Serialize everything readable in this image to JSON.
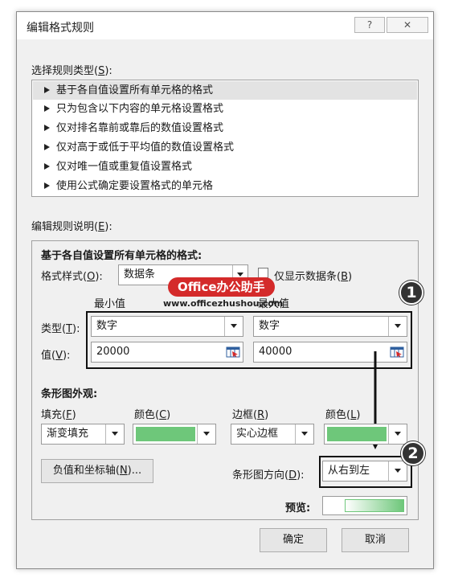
{
  "dialog": {
    "title": "编辑格式规则",
    "help_glyph": "?",
    "close_glyph": "✕"
  },
  "rule_type": {
    "label": "选择规则类型(",
    "label_key": "S",
    "label_tail": "):",
    "items": [
      "基于各自值设置所有单元格的格式",
      "只为包含以下内容的单元格设置格式",
      "仅对排名靠前或靠后的数值设置格式",
      "仅对高于或低于平均值的数值设置格式",
      "仅对唯一值或重复值设置格式",
      "使用公式确定要设置格式的单元格"
    ]
  },
  "edit_desc": {
    "label": "编辑规则说明(",
    "label_key": "E",
    "label_tail": "):",
    "heading": "基于各自值设置所有单元格的格式:",
    "format_style_label": "格式样式(",
    "format_style_key": "O",
    "format_style_tail": "):",
    "format_style_value": "数据条",
    "show_bar_only_label": "仅显示数据条(",
    "show_bar_only_key": "B",
    "show_bar_only_tail": ")",
    "show_bar_only_checked": false,
    "min_header": "最小值",
    "max_header": "最大值",
    "type_label": "类型(",
    "type_key": "T",
    "type_tail": "):",
    "value_label": "值(",
    "value_key": "V",
    "value_tail": "):",
    "min_type": "数字",
    "max_type": "数字",
    "min_value": "20000",
    "max_value": "40000"
  },
  "bar_appearance": {
    "heading": "条形图外观:",
    "fill_label": "填充(",
    "fill_key": "F",
    "fill_tail": ")",
    "fill_color_label": "颜色(",
    "fill_color_key": "C",
    "fill_color_tail": ")",
    "border_label": "边框(",
    "border_key": "R",
    "border_tail": ")",
    "border_color_label": "颜色(",
    "border_color_key": "L",
    "border_color_tail": ")",
    "fill_value": "渐变填充",
    "border_value": "实心边框",
    "bar_color": "#6ec77a",
    "negative_axis_label": "负值和坐标轴(",
    "negative_axis_key": "N",
    "negative_axis_tail": ")...",
    "direction_label": "条形图方向(",
    "direction_key": "D",
    "direction_tail": "):",
    "direction_value": "从右到左",
    "preview_label": "预览:"
  },
  "footer": {
    "ok": "确定",
    "cancel": "取消"
  },
  "annotations": {
    "badge1": "1",
    "badge2": "2",
    "watermark_brand": "Office办公助手",
    "watermark_url": "www.officezhushou.com"
  },
  "colors": {
    "accent_red": "#d42a2a",
    "bar_green": "#6ec77a"
  }
}
